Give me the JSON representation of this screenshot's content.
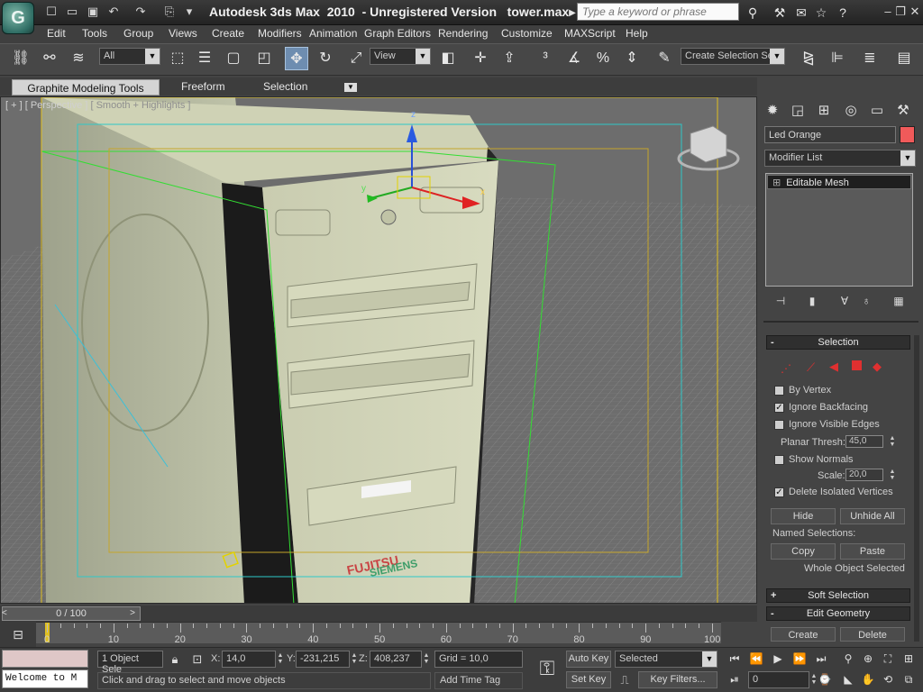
{
  "title_bar": {
    "title": "Autodesk 3ds Max  2010  - Unregistered Version   tower.max",
    "search_placeholder": "Type a keyword or phrase"
  },
  "menu": [
    "Edit",
    "Tools",
    "Group",
    "Views",
    "Create",
    "Modifiers",
    "Animation",
    "Graph Editors",
    "Rendering",
    "Customize",
    "MAXScript",
    "Help"
  ],
  "toolbar": {
    "selection_filter": "All",
    "reference_coord": "View",
    "named_selection_set": "Create Selection Se"
  },
  "ribbon": {
    "tabs": [
      "Graphite Modeling Tools",
      "Freeform",
      "Selection"
    ]
  },
  "viewport": {
    "label_plus": "[ + ]",
    "label_view": "[ Perspective ]",
    "label_shading": "[ Smooth + Highlights ]",
    "brand_text_1": "FUJITSU",
    "brand_text_2": "SIEMENS",
    "gizmo_z": "z",
    "gizmo_y": "y",
    "gizmo_x": "x"
  },
  "command_panel": {
    "object_name": "Led Orange",
    "object_color": "#f05a5a",
    "modifier_list": "Modifier List",
    "stack_item": "Editable Mesh",
    "selection_rollout": {
      "title": "Selection",
      "by_vertex": {
        "label": "By Vertex",
        "checked": false
      },
      "ignore_backfacing": {
        "label": "Ignore Backfacing",
        "checked": true
      },
      "ignore_visible_edges": {
        "label": "Ignore Visible Edges",
        "checked": false
      },
      "planar_thresh_label": "Planar Thresh:",
      "planar_thresh_value": "45,0",
      "show_normals": {
        "label": "Show Normals",
        "checked": false
      },
      "scale_label": "Scale:",
      "scale_value": "20,0",
      "delete_isolated": {
        "label": "Delete Isolated Vertices",
        "checked": true
      },
      "hide_label": "Hide",
      "unhide_all_label": "Unhide All",
      "named_selections_label": "Named Selections:",
      "copy_label": "Copy",
      "paste_label": "Paste",
      "status_text": "Whole Object Selected"
    },
    "soft_selection_title": "Soft Selection",
    "edit_geometry_title": "Edit Geometry",
    "create_label": "Create",
    "delete_label": "Delete"
  },
  "timeline": {
    "slider_text": "0 / 100",
    "ticks": [
      "0",
      "10",
      "20",
      "30",
      "40",
      "50",
      "60",
      "70",
      "80",
      "90",
      "100"
    ]
  },
  "status": {
    "welcome": "Welcome to M",
    "selection_info": "1 Object Sele",
    "x_label": "X:",
    "x_value": "14,0",
    "y_label": "Y:",
    "y_value": "-231,215",
    "z_label": "Z:",
    "z_value": "408,237",
    "grid": "Grid = 10,0",
    "prompt": "Click and drag to select and move objects",
    "add_time_tag": "Add Time Tag",
    "auto_key": "Auto Key",
    "set_key": "Set Key",
    "key_mode": "Selected",
    "key_filters": "Key Filters...",
    "frame_field": "0"
  }
}
